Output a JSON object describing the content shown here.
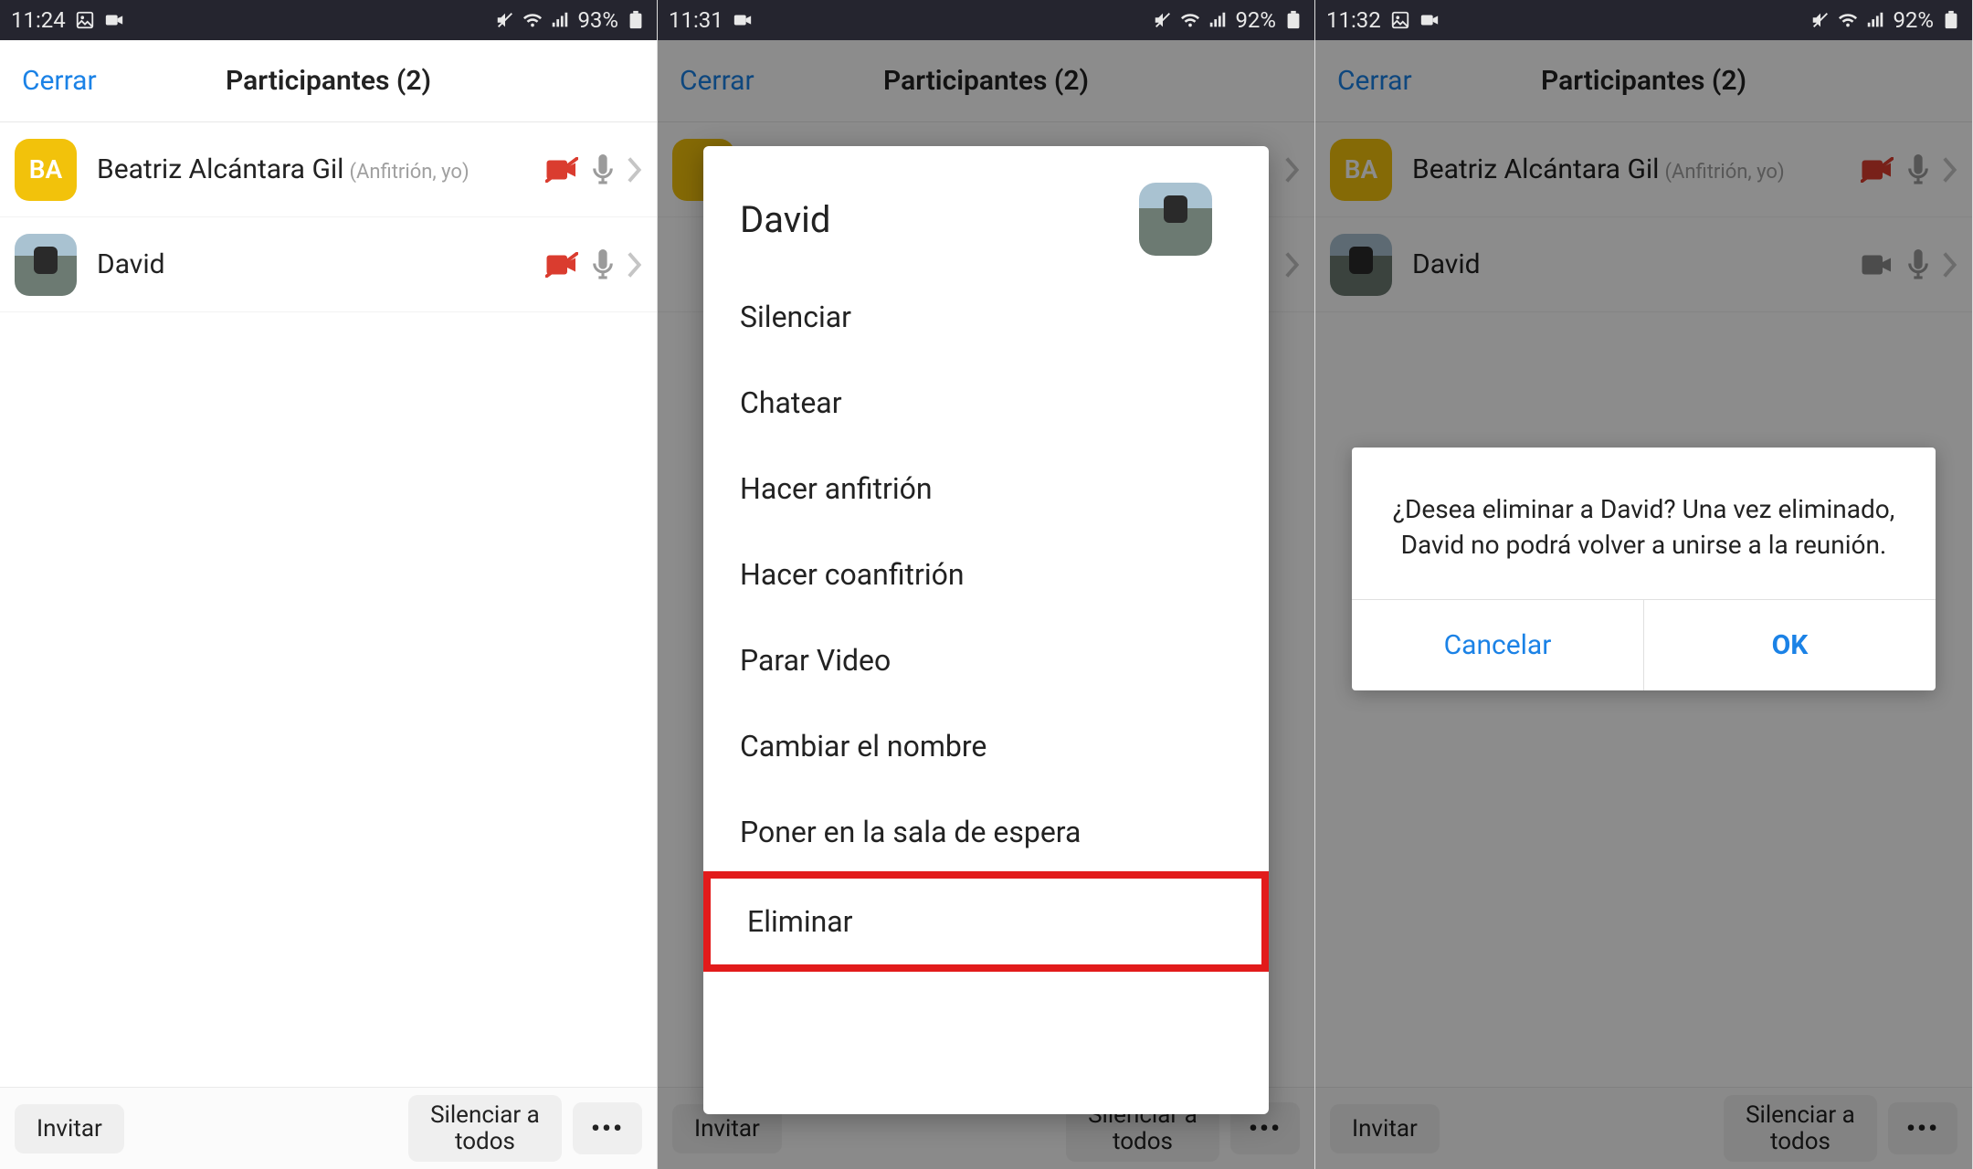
{
  "screens": [
    {
      "statusbar": {
        "time": "11:24",
        "battery": "93%"
      },
      "header": {
        "close": "Cerrar",
        "title": "Participantes (2)"
      },
      "participants": [
        {
          "avatar_text": "BA",
          "name": "Beatriz Alcántara Gil",
          "role": "(Anfitrión, yo)",
          "cam": "off"
        },
        {
          "name": "David",
          "cam": "off"
        }
      ],
      "bottom": {
        "invite": "Invitar",
        "muteall": "Silenciar a\ntodos"
      }
    },
    {
      "statusbar": {
        "time": "11:31",
        "battery": "92%"
      },
      "header": {
        "close": "Cerrar",
        "title": "Participantes (2)"
      },
      "sheet": {
        "title": "David",
        "items": [
          "Silenciar",
          "Chatear",
          "Hacer anfitrión",
          "Hacer coanfitrión",
          "Parar Video",
          "Cambiar el nombre",
          "Poner en la sala de espera",
          "Eliminar"
        ]
      },
      "bottom": {
        "invite": "Invitar",
        "muteall": "Silenciar a\ntodos"
      }
    },
    {
      "statusbar": {
        "time": "11:32",
        "battery": "92%"
      },
      "header": {
        "close": "Cerrar",
        "title": "Participantes (2)"
      },
      "participants": [
        {
          "avatar_text": "BA",
          "name": "Beatriz Alcántara Gil",
          "role": "(Anfitrión, yo)",
          "cam": "off"
        },
        {
          "name": "David",
          "cam": "on"
        }
      ],
      "dialog": {
        "text": "¿Desea eliminar a David? Una vez eliminado, David no podrá volver a unirse a la reunión.",
        "cancel": "Cancelar",
        "ok": "OK"
      },
      "bottom": {
        "invite": "Invitar",
        "muteall": "Silenciar a\ntodos"
      }
    }
  ]
}
